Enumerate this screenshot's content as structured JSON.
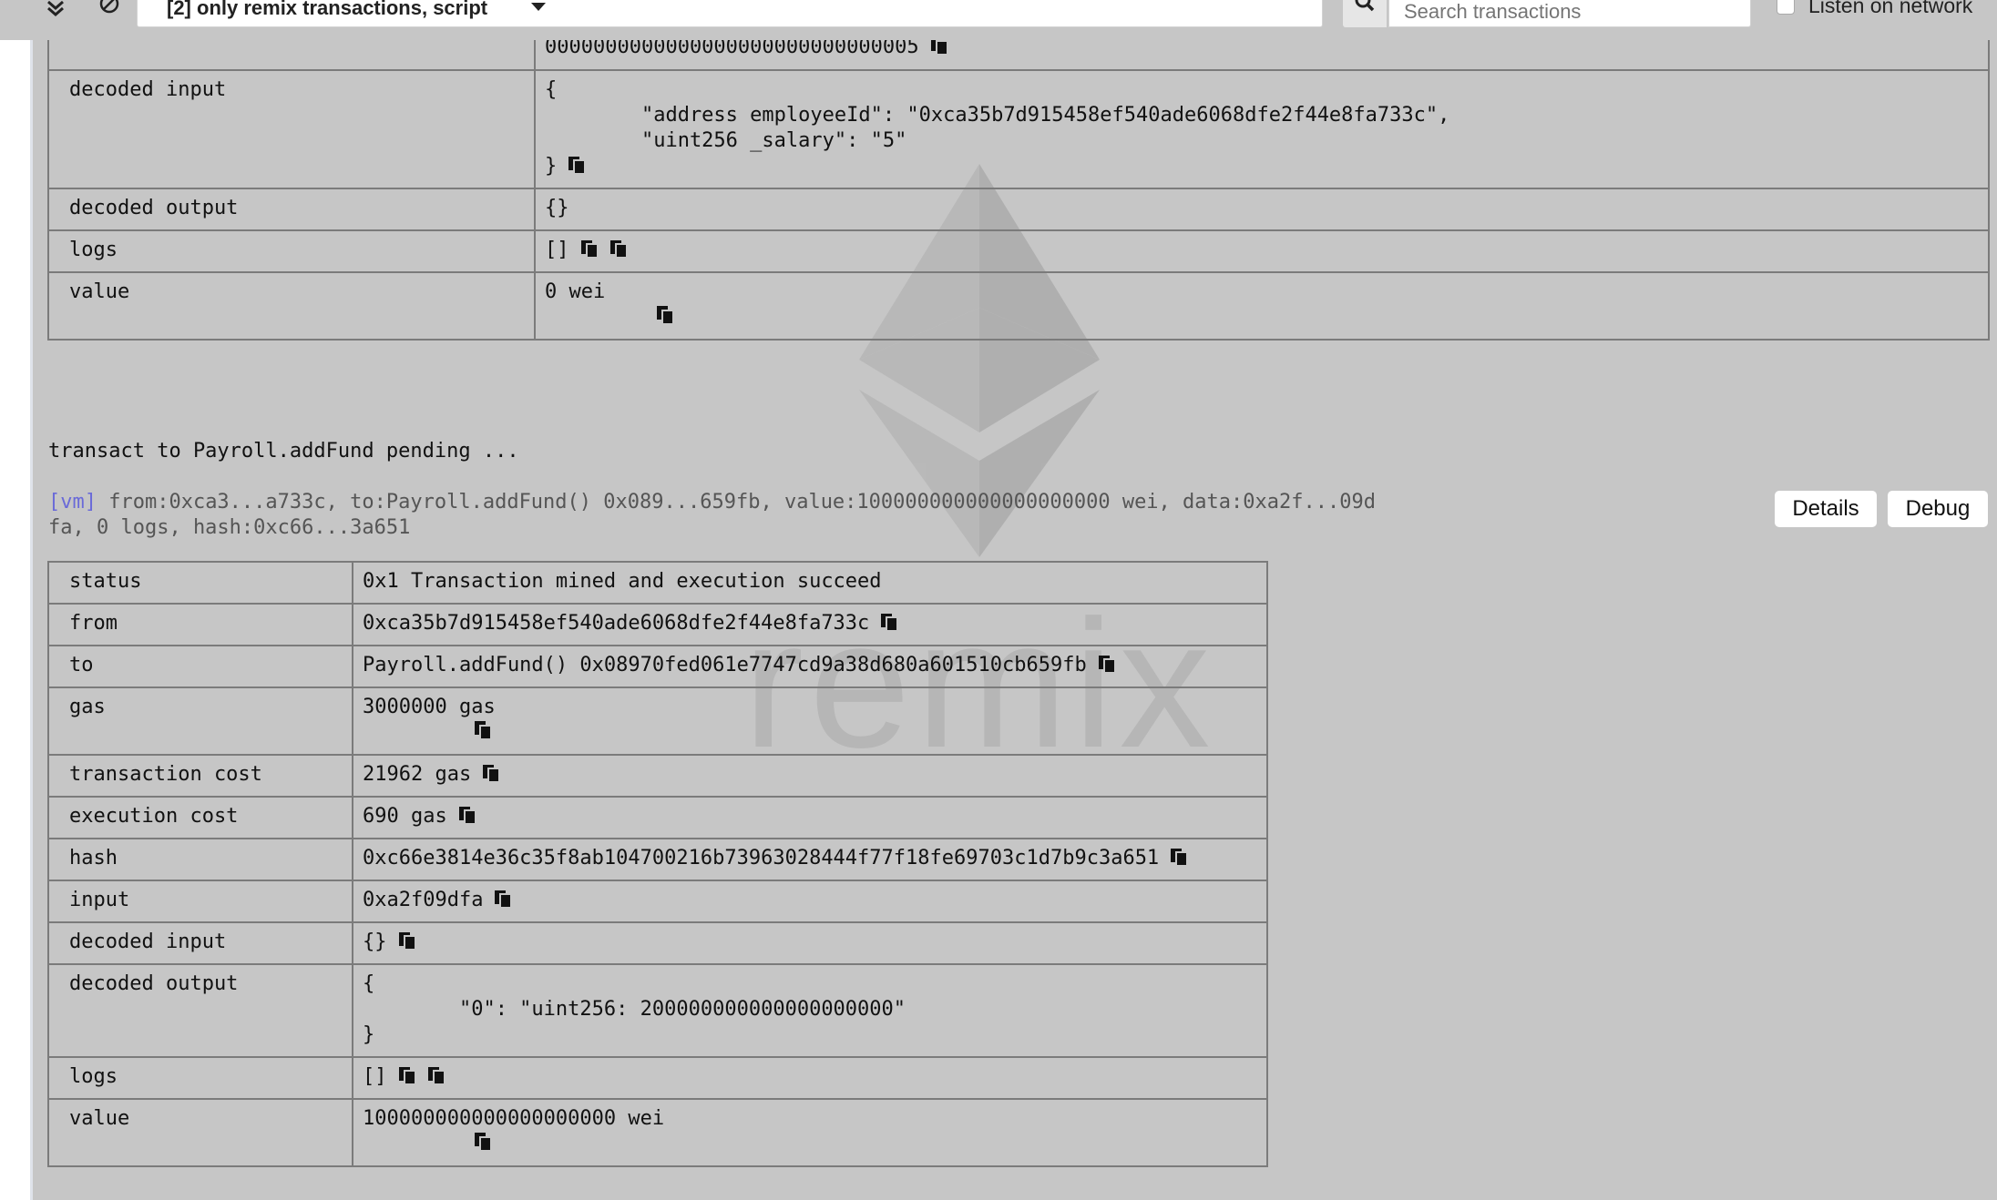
{
  "toolbar": {
    "filter_label": "[2] only remix transactions, script",
    "search_placeholder": "Search transactions",
    "listen_label": "Listen on network"
  },
  "prev_tx": {
    "rows": [
      {
        "key": "",
        "value": "0000000000000000000000000000005"
      },
      {
        "key": "decoded input",
        "value": "{\n        \"address employeeId\": \"0xca35b7d915458ef540ade6068dfe2f44e8fa733c\",\n        \"uint256 _salary\": \"5\"\n}"
      },
      {
        "key": "decoded output",
        "value": "{}"
      },
      {
        "key": "logs",
        "value": "[]"
      },
      {
        "key": "value",
        "value": "0 wei"
      }
    ]
  },
  "pending_text": "transact to Payroll.addFund pending ...",
  "log": {
    "tag": "[vm]",
    "text": " from:0xca3...a733c, to:Payroll.addFund() 0x089...659fb, value:100000000000000000000 wei, data:0xa2f...09d\nfa, 0 logs, hash:0xc66...3a651",
    "details_label": "Details",
    "debug_label": "Debug"
  },
  "tx": {
    "rows": [
      {
        "key": "status",
        "value": "0x1 Transaction mined and execution succeed"
      },
      {
        "key": "from",
        "value": "0xca35b7d915458ef540ade6068dfe2f44e8fa733c"
      },
      {
        "key": "to",
        "value": "Payroll.addFund() 0x08970fed061e7747cd9a38d680a601510cb659fb"
      },
      {
        "key": "gas",
        "value": "3000000 gas"
      },
      {
        "key": "transaction cost",
        "value": "21962 gas"
      },
      {
        "key": "execution cost",
        "value": "690 gas"
      },
      {
        "key": "hash",
        "value": "0xc66e3814e36c35f8ab104700216b73963028444f77f18fe69703c1d7b9c3a651"
      },
      {
        "key": "input",
        "value": "0xa2f09dfa"
      },
      {
        "key": "decoded input",
        "value": "{}"
      },
      {
        "key": "decoded output",
        "value": "{\n        \"0\": \"uint256: 200000000000000000000\"\n}"
      },
      {
        "key": "logs",
        "value": "[]"
      },
      {
        "key": "value",
        "value": "100000000000000000000 wei"
      }
    ]
  },
  "watermark_text": "remix",
  "icons": {
    "copy": "copy-icon",
    "search": "search-icon",
    "collapse": "double-chevron-down-icon",
    "clear": "ban-icon"
  }
}
